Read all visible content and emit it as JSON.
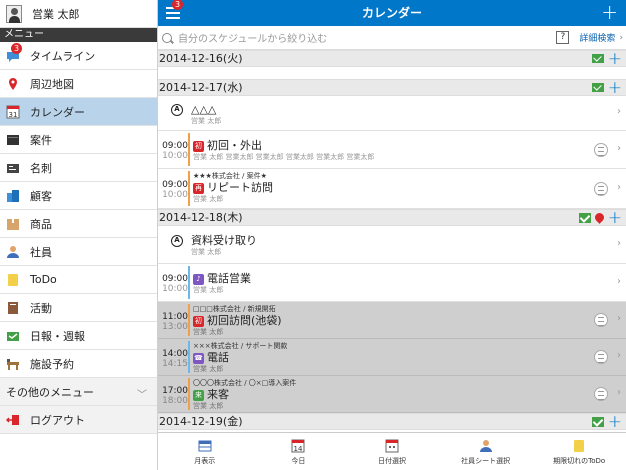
{
  "sidebar": {
    "user_name": "営業 太郎",
    "menu_header": "メニュー",
    "items": [
      {
        "label": "タイムライン",
        "badge": "3"
      },
      {
        "label": "周辺地図"
      },
      {
        "label": "カレンダー"
      },
      {
        "label": "案件"
      },
      {
        "label": "名刺"
      },
      {
        "label": "顧客"
      },
      {
        "label": "商品"
      },
      {
        "label": "社員"
      },
      {
        "label": "ToDo"
      },
      {
        "label": "活動"
      },
      {
        "label": "日報・週報"
      },
      {
        "label": "施設予約"
      }
    ],
    "other_menu": "その他のメニュー",
    "logout": "ログアウト",
    "calendar_icon_text": "31"
  },
  "topbar": {
    "title": "カレンダー",
    "menu_badge": "3",
    "add_label": "+"
  },
  "search": {
    "placeholder": "自分のスケジュールから絞り込む",
    "help": "?",
    "advanced": "詳細検索"
  },
  "days": [
    {
      "date": "2014-12-16(火)"
    },
    {
      "date": "2014-12-17(水)"
    },
    {
      "date": "2014-12-18(木)"
    },
    {
      "date": "2014-12-19(金)"
    }
  ],
  "events": [
    {
      "title": "△△△",
      "sub": "営業 太郎"
    },
    {
      "start": "09:00",
      "end": "10:00",
      "cat": "初",
      "title": "初回・外出",
      "sub": "営業 太郎 営業太郎 営業太郎 営業太郎 営業太郎 営業太郎"
    },
    {
      "start": "09:00",
      "end": "10:00",
      "company": "★★★株式会社 / 案件★",
      "cat": "再",
      "title": "リピート訪問",
      "sub": "営業 太郎"
    },
    {
      "title": "資料受け取り",
      "sub": "営業 太郎"
    },
    {
      "start": "09:00",
      "end": "10:00",
      "cat": "♪",
      "title": "電話営業",
      "sub": "営業 太郎"
    },
    {
      "start": "11:00",
      "end": "13:00",
      "company": "□□□株式会社 / 新規開拓",
      "cat": "初",
      "title": "初回訪問(池袋)",
      "sub": "営業 太郎"
    },
    {
      "start": "14:00",
      "end": "14:15",
      "company": "×××株式会社 / サポート関款",
      "cat": "☎",
      "title": "電話",
      "sub": "営業 太郎"
    },
    {
      "start": "17:00",
      "end": "18:00",
      "company": "〇〇〇株式会社 / 〇×□導入案件",
      "cat": "来",
      "title": "来客",
      "sub": "営業 太郎"
    }
  ],
  "bottom_tabs": [
    {
      "label": "月表示"
    },
    {
      "label": "今日",
      "icon_text": "14"
    },
    {
      "label": "日付選択"
    },
    {
      "label": "社員シート選択"
    },
    {
      "label": "期限切れのToDo"
    }
  ],
  "colors": {
    "brand": "#0077c8",
    "active_item": "#b9d4ea",
    "cat_first": "#d9262b",
    "cat_phone": "#7e57c2",
    "cat_visit": "#43a047"
  }
}
